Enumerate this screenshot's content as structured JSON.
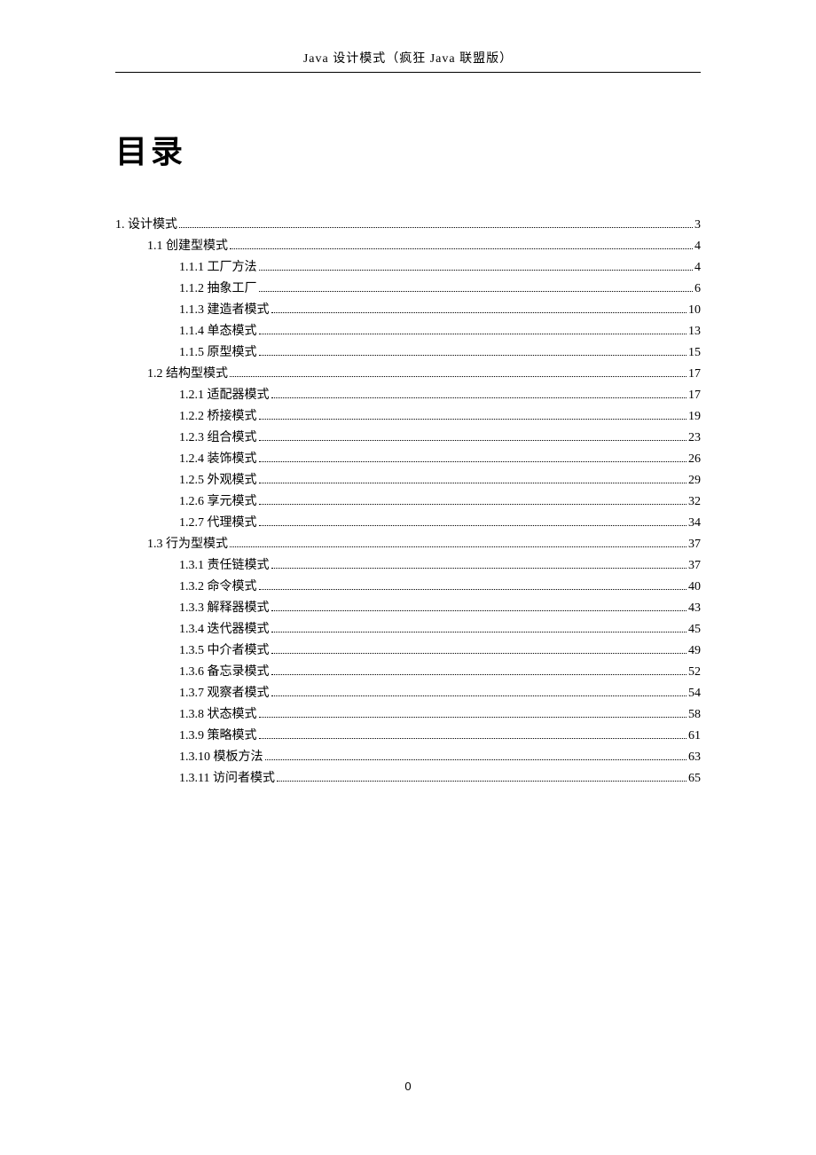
{
  "header": {
    "title": "Java 设计模式（疯狂 Java 联盟版）"
  },
  "toc": {
    "title": "目录",
    "entries": [
      {
        "level": 1,
        "label": "1.  设计模式",
        "page": "3"
      },
      {
        "level": 2,
        "label": "1.1  创建型模式",
        "page": "4"
      },
      {
        "level": 3,
        "label": "1.1.1  工厂方法",
        "page": "4"
      },
      {
        "level": 3,
        "label": "1.1.2  抽象工厂",
        "page": "6"
      },
      {
        "level": 3,
        "label": "1.1.3  建造者模式",
        "page": "10"
      },
      {
        "level": 3,
        "label": "1.1.4  单态模式",
        "page": "13"
      },
      {
        "level": 3,
        "label": "1.1.5  原型模式",
        "page": "15"
      },
      {
        "level": 2,
        "label": "1.2  结构型模式",
        "page": "17"
      },
      {
        "level": 3,
        "label": "1.2.1  适配器模式",
        "page": "17"
      },
      {
        "level": 3,
        "label": "1.2.2  桥接模式",
        "page": "19"
      },
      {
        "level": 3,
        "label": "1.2.3  组合模式",
        "page": "23"
      },
      {
        "level": 3,
        "label": "1.2.4  装饰模式",
        "page": "26"
      },
      {
        "level": 3,
        "label": "1.2.5  外观模式",
        "page": "29"
      },
      {
        "level": 3,
        "label": "1.2.6  享元模式",
        "page": "32"
      },
      {
        "level": 3,
        "label": "1.2.7  代理模式",
        "page": "34"
      },
      {
        "level": 2,
        "label": "1.3  行为型模式",
        "page": "37"
      },
      {
        "level": 3,
        "label": "1.3.1  责任链模式",
        "page": "37"
      },
      {
        "level": 3,
        "label": "1.3.2  命令模式",
        "page": "40"
      },
      {
        "level": 3,
        "label": "1.3.3  解释器模式",
        "page": "43"
      },
      {
        "level": 3,
        "label": "1.3.4  迭代器模式",
        "page": "45"
      },
      {
        "level": 3,
        "label": "1.3.5  中介者模式",
        "page": "49"
      },
      {
        "level": 3,
        "label": "1.3.6  备忘录模式",
        "page": "52"
      },
      {
        "level": 3,
        "label": "1.3.7  观察者模式",
        "page": "54"
      },
      {
        "level": 3,
        "label": "1.3.8  状态模式",
        "page": "58"
      },
      {
        "level": 3,
        "label": "1.3.9  策略模式",
        "page": "61"
      },
      {
        "level": 3,
        "label": "1.3.10  模板方法",
        "page": "63"
      },
      {
        "level": 3,
        "label": "1.3.11  访问者模式",
        "page": "65"
      }
    ]
  },
  "footer": {
    "page_number": "0"
  }
}
